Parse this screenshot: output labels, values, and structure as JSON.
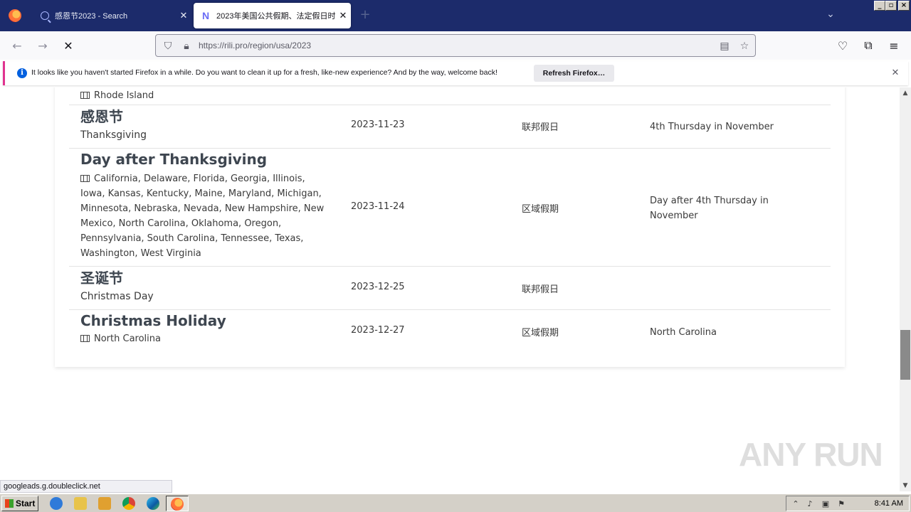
{
  "browser": {
    "tabs": [
      {
        "title": "感恩节2023 - Search",
        "active": false
      },
      {
        "title": "2023年美国公共假期、法定假日时",
        "active": true
      }
    ],
    "new_tab_symbol": "+",
    "url": "https://rili.pro/region/usa/2023"
  },
  "notification": {
    "message": "It looks like you haven't started Firefox in a while. Do you want to clean it up for a fresh, like-new experience? And by the way, welcome back!",
    "button": "Refresh Firefox…"
  },
  "holidays": {
    "partial_region": "Rhode Island",
    "rows": [
      {
        "name_zh": "感恩节",
        "name_en": "Thanksgiving",
        "date": "2023-11-23",
        "type": "联邦假日",
        "rule": "4th Thursday in November"
      },
      {
        "name": "Day after Thanksgiving",
        "regions": "California, Delaware, Florida, Georgia, Illinois, Iowa, Kansas, Kentucky, Maine, Maryland, Michigan, Minnesota, Nebraska, Nevada, New Hampshire, New Mexico, North Carolina, Oklahoma, Oregon, Pennsylvania, South Carolina, Tennessee, Texas, Washington, West Virginia",
        "date": "2023-11-24",
        "type": "区域假期",
        "rule": "Day after 4th Thursday in November"
      },
      {
        "name_zh": "圣诞节",
        "name_en": "Christmas Day",
        "date": "2023-12-25",
        "type": "联邦假日",
        "rule": ""
      },
      {
        "name": "Christmas Holiday",
        "regions": "North Carolina",
        "date": "2023-12-27",
        "type": "区域假期",
        "rule": "North Carolina"
      }
    ]
  },
  "status_link": "googleads.g.doubleclick.net",
  "watermark": "ANY RUN",
  "taskbar": {
    "start": "Start",
    "clock": "8:41 AM"
  }
}
